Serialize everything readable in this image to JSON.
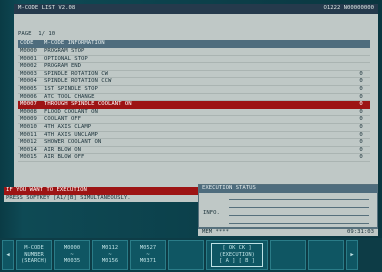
{
  "screen": {
    "title": "M-CODE LIST V2.08",
    "number": "O1222 N00000000"
  },
  "page_label": "PAGE",
  "page_value": "1/ 10",
  "table": {
    "headers": [
      "CODE",
      "M-CODE INFORMATION"
    ],
    "rows": [
      {
        "code": "M0000",
        "info": "PROGRAM STOP",
        "value": ""
      },
      {
        "code": "M0001",
        "info": "OPTIONAL STOP",
        "value": ""
      },
      {
        "code": "M0002",
        "info": "PROGRAM END",
        "value": ""
      },
      {
        "code": "M0003",
        "info": "SPINDLE ROTATION CW",
        "value": "0"
      },
      {
        "code": "M0004",
        "info": "SPINDLE ROTATION CCW",
        "value": "0"
      },
      {
        "code": "M0005",
        "info": "1ST SPINDLE STOP",
        "value": "0"
      },
      {
        "code": "M0006",
        "info": "ATC TOOL CHANGE",
        "value": "0"
      },
      {
        "code": "M0007",
        "info": "THROUGH SPINDLE COOLANT ON",
        "value": "0"
      },
      {
        "code": "M0008",
        "info": "FLOOD COOLANT ON",
        "value": "0"
      },
      {
        "code": "M0009",
        "info": "COOLANT OFF",
        "value": "0"
      },
      {
        "code": "M0010",
        "info": "4TH AXIS CLAMP",
        "value": "0"
      },
      {
        "code": "M0011",
        "info": "4TH AXIS UNCLAMP",
        "value": "0"
      },
      {
        "code": "M0012",
        "info": "SHOWER COOLANT ON",
        "value": "0"
      },
      {
        "code": "M0014",
        "info": "AIR BLOW ON",
        "value": "0"
      },
      {
        "code": "M0015",
        "info": "AIR BLOW OFF",
        "value": "0"
      }
    ]
  },
  "messages": {
    "line1": "IF YOU WANT TO EXECUTION",
    "line2": "PRESS SOFTKEY [A1/[B] SIMULTANEOUSLY."
  },
  "exec_panel": {
    "title": "EXECUTION STATUS",
    "info_label": "INFO."
  },
  "status_bar": {
    "mode": "MEM ****",
    "time": "09:31:03"
  },
  "softkeys": [
    {
      "line1": "M-CODE",
      "line2": "NUMBER",
      "line3": "(SEARCH)"
    },
    {
      "line1": "M0000",
      "line2": "~",
      "line3": "M0035"
    },
    {
      "line1": "M0112",
      "line2": "~",
      "line3": "M0156"
    },
    {
      "line1": "M0527",
      "line2": "~",
      "line3": "M0371"
    }
  ],
  "exec_key": {
    "line1": "[ OK CK ]",
    "line2": "(EXECUTION)",
    "line3": "[ A ] [ B ]"
  }
}
